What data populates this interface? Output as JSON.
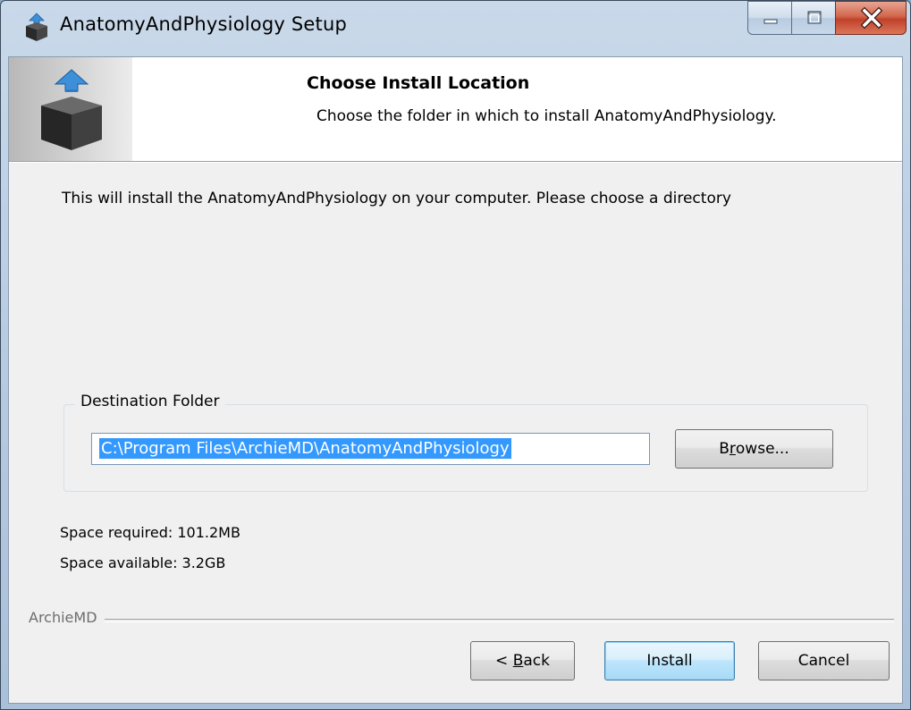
{
  "window": {
    "title": "AnatomyAndPhysiology Setup"
  },
  "header": {
    "title": "Choose Install Location",
    "subtitle": "Choose the folder in which to install AnatomyAndPhysiology."
  },
  "body": {
    "description": "This will install the AnatomyAndPhysiology on your computer. Please choose a directory"
  },
  "destination": {
    "group_label": "Destination Folder",
    "path_value": "C:\\Program Files\\ArchieMD\\AnatomyAndPhysiology",
    "browse_label_pre": "B",
    "browse_label_accel": "r",
    "browse_label_post": "owse..."
  },
  "space": {
    "required": "Space required: 101.2MB",
    "available": "Space available: 3.2GB"
  },
  "footer": {
    "brand": "ArchieMD",
    "back_label_pre": "< ",
    "back_label_accel": "B",
    "back_label_post": "ack",
    "install_label": "Install",
    "cancel_label": "Cancel"
  },
  "colors": {
    "selection": "#3399ff",
    "close_button": "#c2412a",
    "default_button_border": "#3c7fb1"
  },
  "icons": {
    "title": "installer-box-icon",
    "logo": "installer-box-icon",
    "minimize": "minimize-icon",
    "maximize": "maximize-icon",
    "close": "close-icon"
  }
}
